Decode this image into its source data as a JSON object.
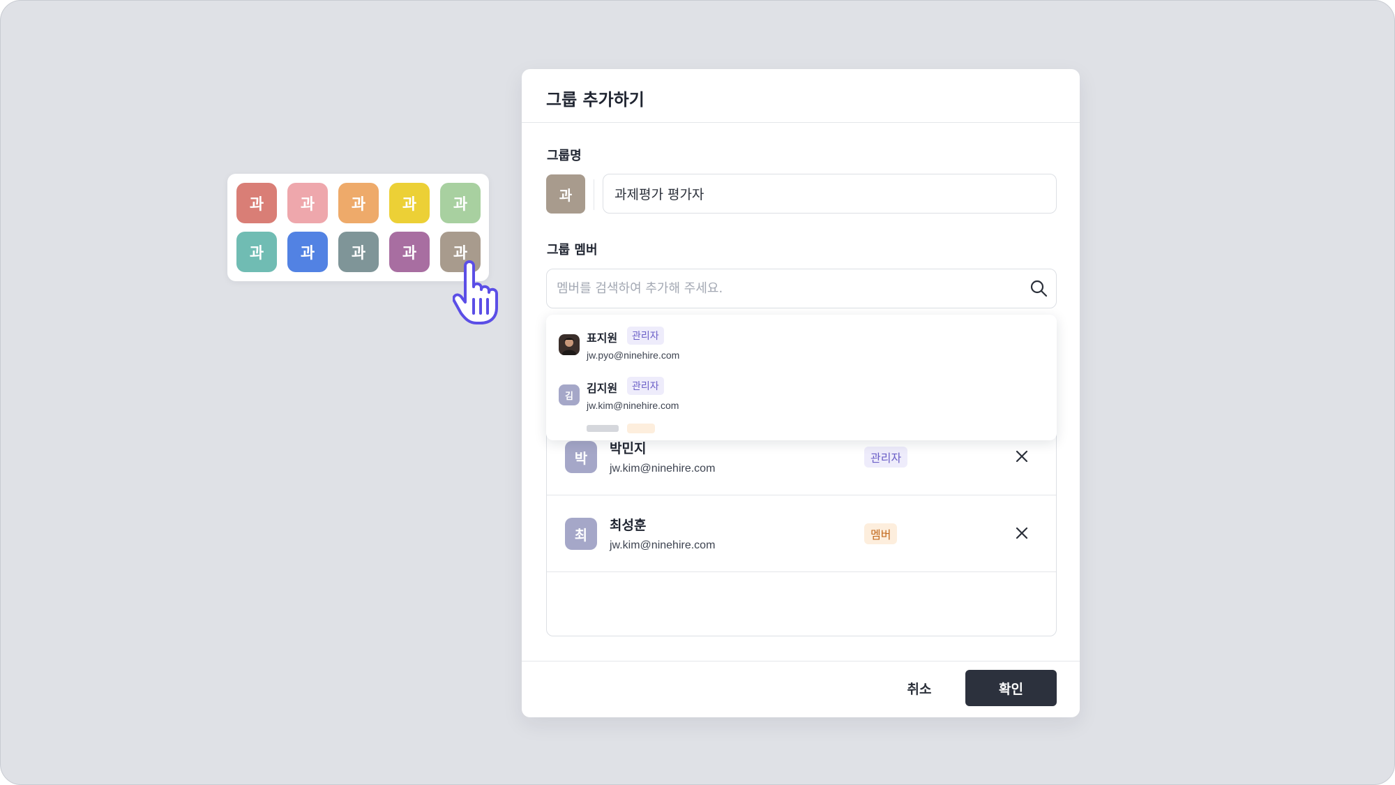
{
  "palette": {
    "glyph": "과",
    "colors": [
      "#d97e76",
      "#eea7ac",
      "#eeaa6a",
      "#ecd036",
      "#a8d0a0",
      "#70bcb3",
      "#5282e3",
      "#7f9598",
      "#a86ea1",
      "#a89b8d"
    ],
    "selected_index": 9
  },
  "modal": {
    "title": "그룹 추가하기",
    "group_name_label": "그룹명",
    "group_icon_glyph": "과",
    "group_icon_color": "#a89b8d",
    "group_name_value": "과제평가 평가자",
    "members_label": "그룹 멤버",
    "search_placeholder": "멤버를 검색하여 추가해 주세요.",
    "search_icon": "search-icon",
    "cancel_label": "취소",
    "confirm_label": "확인"
  },
  "dropdown": {
    "items": [
      {
        "name": "표지원",
        "role": "관리자",
        "email": "jw.pyo@ninehire.com",
        "avatar": "photo"
      },
      {
        "name": "김지원",
        "role": "관리자",
        "email": "jw.kim@ninehire.com",
        "avatar": "김"
      }
    ]
  },
  "members": [
    {
      "initial": "박",
      "name": "박민지",
      "email": "jw.kim@ninehire.com",
      "role": "관리자",
      "role_type": "admin"
    },
    {
      "initial": "최",
      "name": "최성훈",
      "email": "jw.kim@ninehire.com",
      "role": "멤버",
      "role_type": "member"
    }
  ],
  "colors": {
    "admin_badge_bg": "#eeecfb",
    "admin_badge_text": "#6b5fc7",
    "member_badge_bg": "#fdeedd",
    "member_badge_text": "#c26a1e",
    "primary_button": "#2c313d",
    "cursor_accent": "#5b4ee6"
  }
}
